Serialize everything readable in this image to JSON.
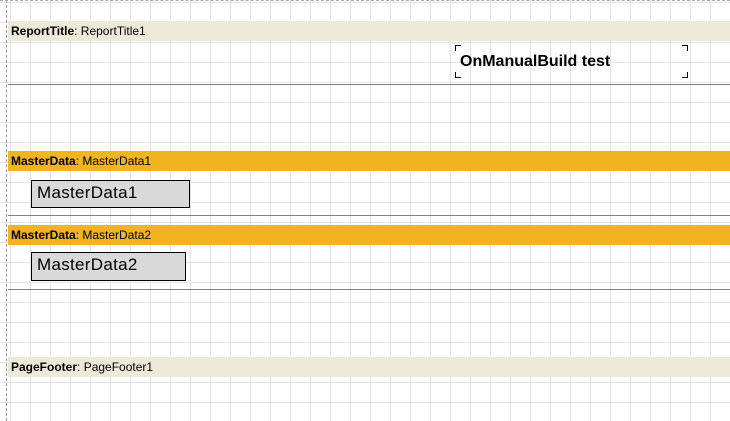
{
  "designer": {
    "bands": [
      {
        "type_label": "ReportTitle",
        "separator": ": ",
        "name": "ReportTitle1",
        "header_color": "#ece9d8",
        "objects": [
          {
            "text": "OnManualBuild test"
          }
        ]
      },
      {
        "type_label": "MasterData",
        "separator": ": ",
        "name": "MasterData1",
        "header_color": "#efb420",
        "objects": [
          {
            "text": "MasterData1"
          }
        ]
      },
      {
        "type_label": "MasterData",
        "separator": ": ",
        "name": "MasterData2",
        "header_color": "#efb420",
        "objects": [
          {
            "text": "MasterData2"
          }
        ]
      },
      {
        "type_label": "PageFooter",
        "separator": ": ",
        "name": "PageFooter1",
        "header_color": "#ece9d8",
        "objects": []
      }
    ],
    "grid_color": "#e3e3e3"
  }
}
